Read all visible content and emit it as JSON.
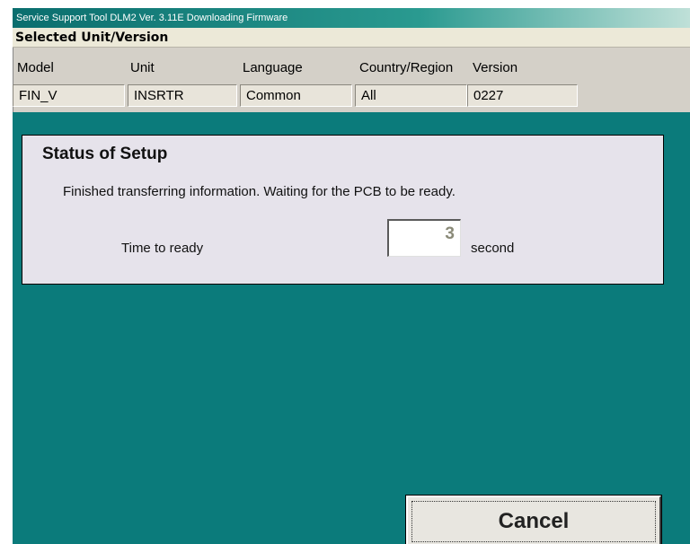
{
  "window": {
    "title": "Service Support Tool DLM2 Ver. 3.11E  Downloading Firmware"
  },
  "selected": {
    "section_label": "Selected Unit/Version",
    "columns": [
      "Model",
      "Unit",
      "Language",
      "Country/Region",
      "Version"
    ],
    "values": [
      "FIN_V",
      "INSRTR",
      "Common",
      "All",
      "0227"
    ]
  },
  "status": {
    "title": "Status of Setup",
    "message": "Finished transferring information. Waiting for the PCB to be ready.",
    "time_label": "Time to ready",
    "time_value": "3",
    "time_unit": "second"
  },
  "actions": {
    "cancel_label": "Cancel"
  },
  "colors": {
    "background": "#0b7b7b",
    "panel": "#e6e3eb",
    "window": "#d4d0c8"
  }
}
